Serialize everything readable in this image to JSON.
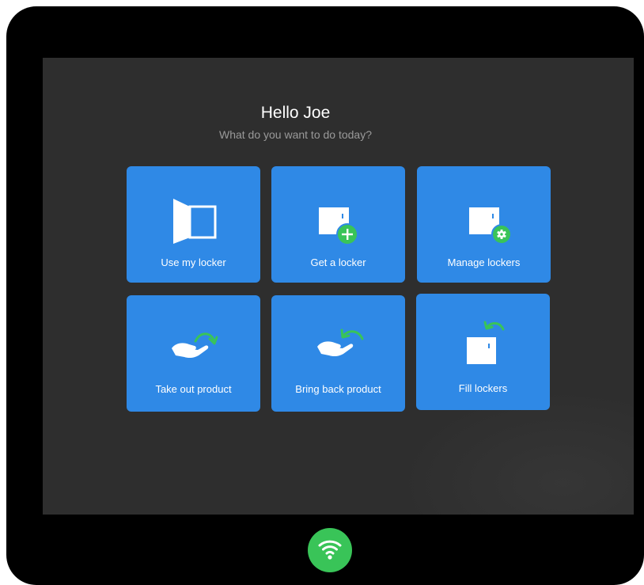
{
  "header": {
    "greeting": "Hello Joe",
    "subtitle": "What do you want to do today?"
  },
  "tiles": [
    {
      "label": "Use my locker",
      "icon": "open-locker-icon"
    },
    {
      "label": "Get a locker",
      "icon": "add-locker-icon"
    },
    {
      "label": "Manage lockers",
      "icon": "manage-locker-icon"
    },
    {
      "label": "Take out product",
      "icon": "take-out-hand-icon"
    },
    {
      "label": "Bring back product",
      "icon": "bring-back-hand-icon"
    },
    {
      "label": "Fill lockers",
      "icon": "fill-locker-icon"
    }
  ],
  "status": {
    "wifi_icon": "wifi-icon"
  },
  "colors": {
    "tile": "#2f89e6",
    "accent_green": "#39c458",
    "screen": "#2e2e2e",
    "bezel": "#000000"
  }
}
